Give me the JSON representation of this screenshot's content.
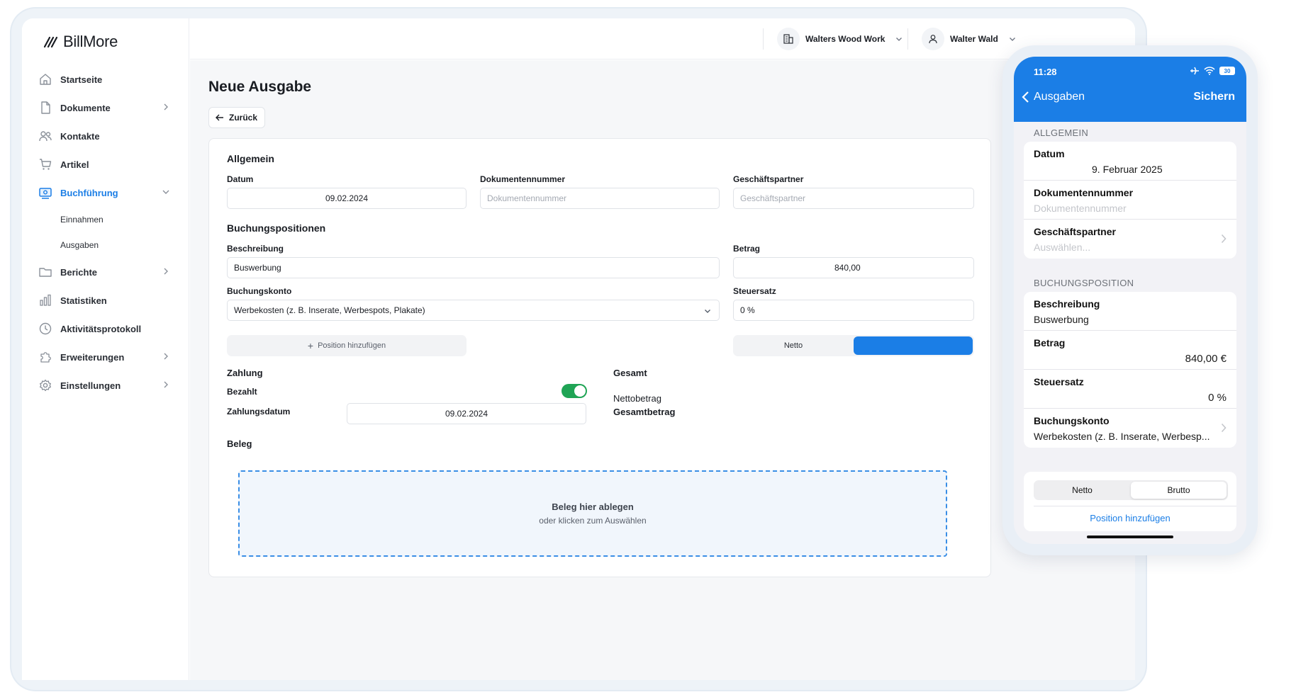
{
  "brand": {
    "name": "BillMore"
  },
  "sidebar": {
    "items": [
      {
        "label": "Startseite",
        "icon": "home-icon",
        "chevron": false
      },
      {
        "label": "Dokumente",
        "icon": "document-icon",
        "chevron": true
      },
      {
        "label": "Kontakte",
        "icon": "contacts-icon",
        "chevron": false
      },
      {
        "label": "Artikel",
        "icon": "cart-icon",
        "chevron": false
      },
      {
        "label": "Buchführung",
        "icon": "accounting-icon",
        "chevron": true,
        "active": true
      },
      {
        "label": "Berichte",
        "icon": "folder-icon",
        "chevron": true
      },
      {
        "label": "Statistiken",
        "icon": "stats-icon",
        "chevron": false
      },
      {
        "label": "Aktivitätsprotokoll",
        "icon": "clock-icon",
        "chevron": false
      },
      {
        "label": "Erweiterungen",
        "icon": "puzzle-icon",
        "chevron": true
      },
      {
        "label": "Einstellungen",
        "icon": "gear-icon",
        "chevron": true
      }
    ],
    "subitems": [
      "Einnahmen",
      "Ausgaben"
    ]
  },
  "topbar": {
    "company": "Walters Wood Work",
    "user": "Walter Wald"
  },
  "page": {
    "title": "Neue Ausgabe",
    "back": "Zurück"
  },
  "form": {
    "general_title": "Allgemein",
    "date_label": "Datum",
    "date_value": "09.02.2024",
    "docnum_label": "Dokumentennummer",
    "docnum_placeholder": "Dokumentennummer",
    "partner_label": "Geschäftspartner",
    "partner_placeholder": "Geschäftspartner",
    "positions_title": "Buchungspositionen",
    "desc_label": "Beschreibung",
    "desc_value": "Buswerbung",
    "amount_label": "Betrag",
    "amount_value": "840,00",
    "account_label": "Buchungskonto",
    "account_value": "Werbekosten (z. B. Inserate, Werbespots, Plakate)",
    "tax_label": "Steuersatz",
    "tax_value": "0 %",
    "add_position": "Position hinzufügen",
    "mode_netto": "Netto",
    "payment_title": "Zahlung",
    "paid_label": "Bezahlt",
    "paid": true,
    "paydate_label": "Zahlungsdatum",
    "paydate_value": "09.02.2024",
    "total_title": "Gesamt",
    "net_label": "Nettobetrag",
    "gross_label": "Gesamtbetrag",
    "receipt_title": "Beleg",
    "drop_title": "Beleg hier ablegen",
    "drop_sub": "oder klicken zum Auswählen"
  },
  "phone": {
    "time": "11:28",
    "battery": "30",
    "back": "Ausgaben",
    "save": "Sichern",
    "general_title": "ALLGEMEIN",
    "date_label": "Datum",
    "date_value": "9. Februar 2025",
    "docnum_label": "Dokumentennummer",
    "docnum_placeholder": "Dokumentennummer",
    "partner_label": "Geschäftspartner",
    "partner_placeholder": "Auswählen...",
    "position_title": "BUCHUNGSPOSITION",
    "desc_label": "Beschreibung",
    "desc_value": "Buswerbung",
    "amount_label": "Betrag",
    "amount_value": "840,00 €",
    "tax_label": "Steuersatz",
    "tax_value": "0 %",
    "account_label": "Buchungskonto",
    "account_value": "Werbekosten (z. B. Inserate, Werbesp...",
    "seg_netto": "Netto",
    "seg_brutto": "Brutto",
    "add_position": "Position hinzufügen"
  },
  "colors": {
    "accent": "#1b7ee6",
    "toggle_on": "#1fa455",
    "background": "#f6f7f9"
  }
}
